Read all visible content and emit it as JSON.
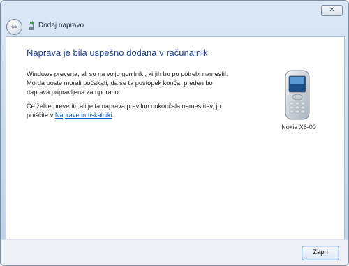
{
  "window": {
    "close_glyph": "✕"
  },
  "nav": {
    "back_glyph": "⇦",
    "title": "Dodaj napravo"
  },
  "content": {
    "heading": "Naprava je bila uspešno dodana v računalnik",
    "paragraph1": "Windows preverja, ali so na voljo gonilniki, ki jih bo po potrebi namestil. Morda boste morali počakati, da se ta postopek konča, preden bo naprava pripravljena za uporabo.",
    "paragraph2_before": "Če želite preveriti, ali je ta naprava pravilno dokončala namestitev, jo poiščite v ",
    "paragraph2_link": "Naprave in tiskalniki",
    "paragraph2_after": ".",
    "device_name": "Nokia X6-00"
  },
  "footer": {
    "close_label": "Zapri"
  },
  "colors": {
    "heading": "#1e3f9b",
    "link": "#0f5fc7",
    "frame": "#c9dbef"
  },
  "icons": {
    "back": "back-arrow-icon",
    "wizard": "add-device-icon",
    "device": "mobile-phone-icon",
    "close": "close-icon"
  }
}
